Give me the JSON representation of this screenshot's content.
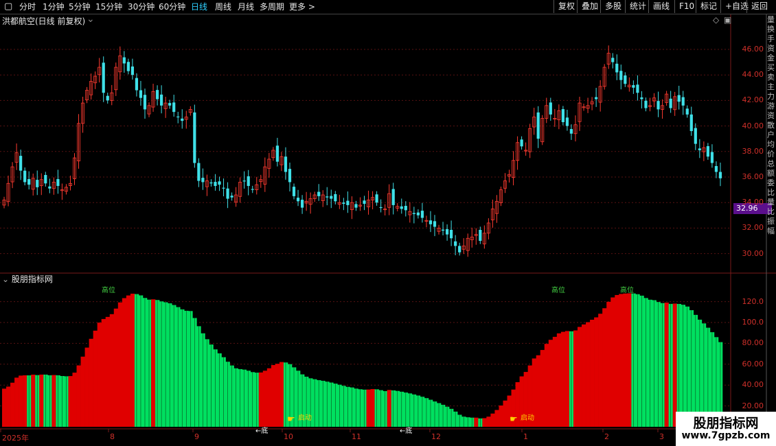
{
  "toolbar": {
    "periods": [
      "分时",
      "1分钟",
      "5分钟",
      "15分钟",
      "30分钟",
      "60分钟",
      "日线",
      "周线",
      "月线",
      "多周期",
      "更多 >"
    ],
    "active_period": "日线",
    "right_buttons": [
      "复权",
      "叠加",
      "多股",
      "统计",
      "画线",
      "F10",
      "标记",
      "+自选",
      "返回"
    ]
  },
  "main_chart": {
    "title": "洪都航空(日线 前复权)",
    "last_price": "32.96",
    "price_tag_color": "#5b0f8c",
    "up_color": "#ff3b30",
    "down_color": "#3fe0e8",
    "y_ticks": [
      "46.00",
      "44.00",
      "42.00",
      "40.00",
      "38.00",
      "36.00",
      "34.00",
      "32.00",
      "30.00"
    ]
  },
  "indicator": {
    "title": "股朋指标网",
    "y_ticks": [
      "120.0",
      "100.0",
      "80.00",
      "60.00",
      "40.00",
      "20.00"
    ],
    "top_labels": [
      "高位",
      "高位",
      "高位"
    ],
    "bottom_labels": [
      "←底",
      "←底"
    ],
    "start_labels": [
      "启动",
      "启动"
    ],
    "label_colors": {
      "top": "#43d043",
      "bottom": "#ffffff",
      "start": "#ffd200"
    }
  },
  "x_axis": {
    "labels": [
      "2025年",
      "8",
      "9",
      "10",
      "11",
      "12",
      "1",
      "2",
      "3"
    ]
  },
  "watermark": {
    "title": "股朋指标网",
    "url": "www.7gpzb.com"
  },
  "side_text": "量换手资金买卖主力游资散户均价总额委比量比振幅",
  "chart_data": {
    "type": "candlestick",
    "title": "洪都航空(日线 前复权)",
    "ylim": [
      29,
      47.5
    ],
    "close": [
      34.2,
      35.5,
      36.8,
      37.9,
      36.5,
      35.6,
      35.4,
      35.9,
      35.2,
      35.8,
      35.5,
      35.1,
      35.6,
      35.3,
      35.0,
      35.2,
      35.5,
      37.5,
      40.2,
      41.8,
      42.8,
      43.5,
      43.9,
      44.6,
      42.6,
      42.0,
      42.6,
      44.6,
      45.5,
      44.9,
      44.3,
      44.0,
      42.8,
      42.2,
      41.3,
      41.6,
      42.7,
      42.1,
      41.6,
      41.8,
      41.6,
      41.1,
      40.7,
      40.4,
      40.7,
      41.3,
      37.1,
      35.7,
      35.6,
      35.7,
      35.5,
      35.3,
      35.4,
      35.1,
      34.3,
      34.4,
      34.6,
      35.6,
      35.7,
      35.3,
      35.0,
      35.4,
      35.8,
      36.8,
      37.4,
      38.1,
      37.2,
      37.6,
      36.4,
      35.6,
      34.5,
      34.1,
      33.6,
      34.1,
      34.3,
      34.6,
      34.5,
      34.6,
      34.4,
      34.3,
      34.1,
      34.0,
      33.9,
      33.8,
      34.0,
      33.6,
      33.8,
      33.9,
      34.2,
      34.4,
      34.0,
      33.6,
      33.5,
      34.7,
      33.8,
      33.7,
      33.5,
      33.4,
      33.3,
      33.1,
      33.0,
      32.8,
      32.6,
      32.3,
      32.1,
      32.0,
      31.8,
      31.5,
      31.2,
      30.6,
      30.1,
      30.6,
      31.2,
      31.3,
      31.5,
      31.0,
      31.6,
      32.4,
      33.5,
      34.1,
      35.0,
      35.7,
      36.2,
      37.3,
      38.7,
      38.4,
      38.1,
      39.8,
      40.7,
      39.0,
      40.6,
      41.6,
      40.9,
      40.6,
      41.2,
      40.3,
      40.0,
      39.4,
      40.1,
      41.8,
      41.5,
      41.6,
      41.9,
      42.1,
      43.1,
      44.6,
      45.7,
      45.0,
      44.2,
      43.6,
      43.3,
      43.2,
      43.0,
      42.6,
      42.1,
      41.4,
      41.6,
      42.2,
      41.3,
      41.6,
      42.5,
      41.4,
      42.3,
      41.9,
      41.6,
      40.9,
      39.6,
      38.6,
      38.1,
      38.3,
      37.6,
      37.1,
      36.4,
      35.9
    ]
  }
}
